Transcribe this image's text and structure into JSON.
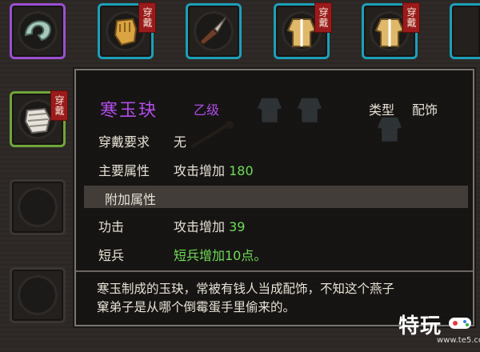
{
  "inventory": {
    "badge_label": "穿戴",
    "slots_top": [
      {
        "name": "jade-ring",
        "equipped": false
      },
      {
        "name": "golden-glove",
        "equipped": true
      },
      {
        "name": "dagger",
        "equipped": false
      },
      {
        "name": "robe-yellow",
        "equipped": true
      },
      {
        "name": "robe-yellow-2",
        "equipped": true
      },
      {
        "name": "partial-item",
        "equipped": false
      }
    ],
    "slot_left": {
      "name": "bandaged-fist",
      "equipped": true
    }
  },
  "tooltip": {
    "title": "寒玉玦",
    "grade": "乙级",
    "type_label": "类型",
    "type_value": "配饰",
    "wear_req_label": "穿戴要求",
    "wear_req_value": "无",
    "main_attr_label": "主要属性",
    "main_attr_text": "攻击增加",
    "main_attr_num": "180",
    "extra_section": "附加属性",
    "attack_label": "功击",
    "attack_text": "攻击增加",
    "attack_num": "39",
    "short_label": "短兵",
    "short_value": "短兵增加10点。",
    "description_line1": "寒玉制成的玉玦，常被有钱人当成配饰，不知这个燕子",
    "description_line2": "窠弟子是从哪个倒霉蛋手里偷来的。"
  },
  "watermark": {
    "text": "特玩",
    "url": "www.te5.com"
  },
  "colors": {
    "rare_purple": "#b04ce8",
    "stat_green": "#6fdc58",
    "badge_red": "#9a1b1b",
    "slot_cyan": "#1c9fb8",
    "slot_purple": "#9b4fd1",
    "slot_green": "#6fa53a"
  }
}
